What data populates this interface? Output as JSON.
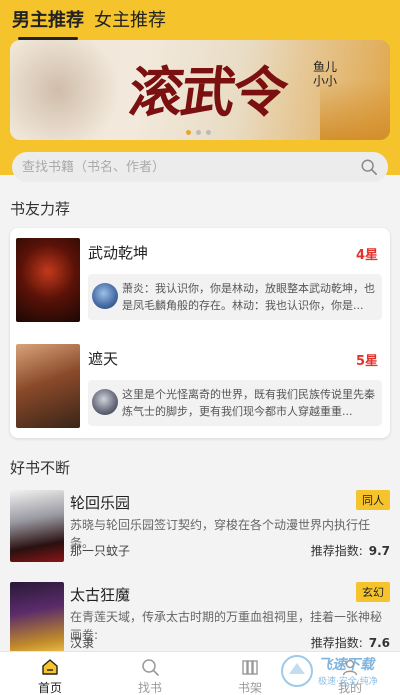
{
  "header": {
    "tabs": [
      {
        "label": "男主推荐",
        "active": true
      },
      {
        "label": "女主推荐",
        "active": false
      }
    ]
  },
  "banner": {
    "title": "滚武令",
    "author": "鱼儿小小",
    "dots": 3,
    "active_dot": 0
  },
  "search": {
    "placeholder": "查找书籍（书名、作者）"
  },
  "recommend": {
    "title": "书友力荐",
    "items": [
      {
        "name": "武动乾坤",
        "stars": "4星",
        "comment": "萧炎：我认识你，你是林动，放眼整本武动乾坤，也是凤毛麟角般的存在。林动：我也认识你，你是..."
      },
      {
        "name": "遮天",
        "stars": "5星",
        "comment": "这里是个光怪离奇的世界，既有我们民族传说里先秦炼气士的脚步，更有我们现今都市人穿越重重..."
      }
    ]
  },
  "good_books": {
    "title": "好书不断",
    "items": [
      {
        "name": "轮回乐园",
        "tag": "同人",
        "desc": "苏晓与轮回乐园签订契约，穿梭在各个动漫世界内执行任务。",
        "author": "那一只蚊子",
        "score_label": "推荐指数:",
        "score": "9.7"
      },
      {
        "name": "太古狂魔",
        "tag": "玄幻",
        "desc": "在青莲天域，传承太古时期的万重血祖祠里，挂着一张神秘画卷:",
        "author": "汉隶",
        "score_label": "推荐指数:",
        "score": "7.6"
      }
    ]
  },
  "bottom_nav": [
    {
      "label": "首页",
      "icon": "home-icon",
      "active": true
    },
    {
      "label": "找书",
      "icon": "search-icon",
      "active": false
    },
    {
      "label": "书架",
      "icon": "bookshelf-icon",
      "active": false
    },
    {
      "label": "我的",
      "icon": "profile-icon",
      "active": false
    }
  ],
  "watermark": {
    "text": "飞速下载",
    "sub": "极速·安全·纯净"
  },
  "colors": {
    "accent": "#f5c32c",
    "star": "#e3322c",
    "background": "#f3f3f3"
  }
}
